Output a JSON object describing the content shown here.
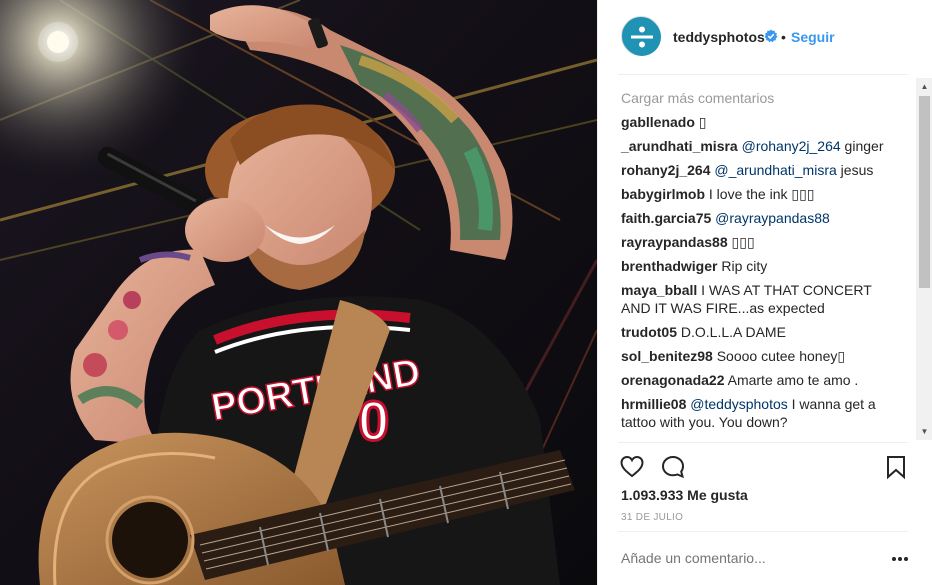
{
  "post": {
    "username": "teddysphotos",
    "separator": "•",
    "follow_label": "Seguir",
    "load_more_label": "Cargar más comentarios",
    "comments": [
      {
        "user": "gabllenado",
        "text": "",
        "mention": "",
        "rest": "▯"
      },
      {
        "user": "_arundhati_misra",
        "text": "",
        "mention": "@rohany2j_264",
        "rest": " ginger"
      },
      {
        "user": "rohany2j_264",
        "text": "",
        "mention": "@_arundhati_misra",
        "rest": " jesus"
      },
      {
        "user": "babygirlmob",
        "text": "I love the ink ▯▯▯",
        "mention": "",
        "rest": ""
      },
      {
        "user": "faith.garcia75",
        "text": "",
        "mention": "@rayraypandas88",
        "rest": ""
      },
      {
        "user": "rayraypandas88",
        "text": "▯▯▯",
        "mention": "",
        "rest": ""
      },
      {
        "user": "brenthadwiger",
        "text": "Rip city",
        "mention": "",
        "rest": ""
      },
      {
        "user": "maya_bball",
        "text": "I WAS AT THAT CONCERT AND IT WAS FIRE...as expected",
        "mention": "",
        "rest": ""
      },
      {
        "user": "trudot05",
        "text": "D.O.L.L.A DAME",
        "mention": "",
        "rest": ""
      },
      {
        "user": "sol_benitez98",
        "text": "Soooo cutee honey▯",
        "mention": "",
        "rest": ""
      },
      {
        "user": "orenagonada22",
        "text": "Amarte amo te amo .",
        "mention": "",
        "rest": ""
      },
      {
        "user": "hrmillie08",
        "text": "",
        "mention": "@teddysphotos",
        "rest": " I wanna get a tattoo with you. You down?"
      }
    ],
    "likes_label": "1.093.933 Me gusta",
    "date_label": "31 DE JULIO",
    "add_comment_placeholder": "Añade un comentario...",
    "icons": {
      "like": "heart-icon",
      "comment": "comment-bubble-icon",
      "save": "bookmark-icon",
      "more": "more-dots-icon",
      "verified": "verified-badge-icon",
      "scroll_up": "▲",
      "scroll_down": "▼"
    },
    "colors": {
      "link": "#3897f0",
      "verified": "#3897f0",
      "mention": "#003569",
      "muted": "#999999"
    }
  },
  "photo": {
    "jersey_text": "PORTLAND",
    "jersey_number": "0"
  }
}
